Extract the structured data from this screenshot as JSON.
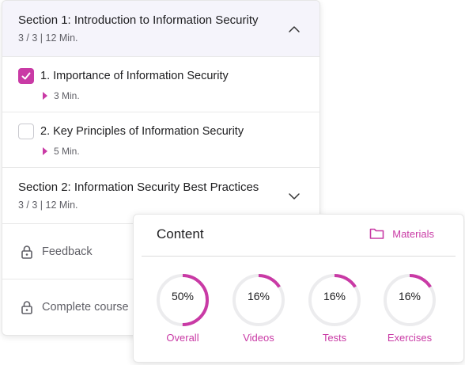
{
  "sections": [
    {
      "title": "Section 1: Introduction to Information Security",
      "meta": "3 / 3 | 12 Min.",
      "expanded": true
    },
    {
      "title": "Section 2: Information Security Best Practices",
      "meta": "3 / 3 | 12 Min.",
      "expanded": false
    }
  ],
  "lessons": [
    {
      "title": "1. Importance of Information Security",
      "duration": "3 Min.",
      "completed": true
    },
    {
      "title": "2. Key Principles of Information Security",
      "duration": "5 Min.",
      "completed": false
    }
  ],
  "locked_items": [
    {
      "label": "Feedback",
      "icon": "lock-icon"
    },
    {
      "label": "Complete course",
      "icon": "lock-icon"
    }
  ],
  "content_panel": {
    "title": "Content",
    "materials_label": "Materials",
    "materials_icon": "folder-icon",
    "stats": [
      {
        "value": "50%",
        "label": "Overall",
        "progress": 0.5
      },
      {
        "value": "16%",
        "label": "Videos",
        "progress": 0.16
      },
      {
        "value": "16%",
        "label": "Tests",
        "progress": 0.16
      },
      {
        "value": "16%",
        "label": "Exercises",
        "progress": 0.16
      }
    ]
  },
  "colors": {
    "accent": "#c93aa5",
    "ring_track": "#ececee",
    "header_bg": "#f5f4fb"
  }
}
